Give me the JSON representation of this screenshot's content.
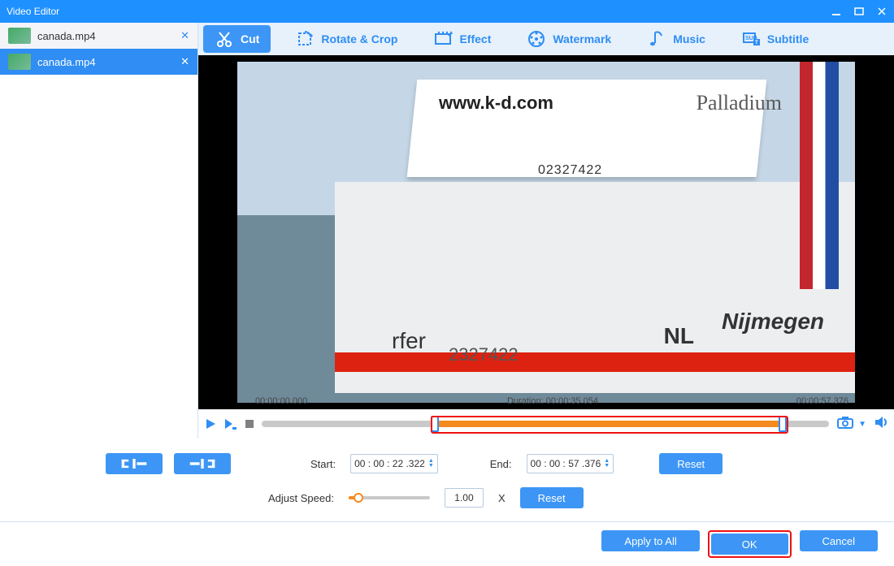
{
  "window": {
    "title": "Video Editor"
  },
  "sidebar": {
    "files": [
      {
        "name": "canada.mp4",
        "active": false
      },
      {
        "name": "canada.mp4",
        "active": true
      }
    ]
  },
  "toolbar": {
    "tabs": [
      {
        "id": "cut",
        "label": "Cut",
        "active": true
      },
      {
        "id": "rotate",
        "label": "Rotate & Crop",
        "active": false
      },
      {
        "id": "effect",
        "label": "Effect",
        "active": false
      },
      {
        "id": "watermark",
        "label": "Watermark",
        "active": false
      },
      {
        "id": "music",
        "label": "Music",
        "active": false
      },
      {
        "id": "subtitle",
        "label": "Subtitle",
        "active": false
      }
    ]
  },
  "preview": {
    "boat_url": "www.k-d.com",
    "boat_name": "Palladium",
    "boat_phone": "02327422",
    "boat_side": "rfer",
    "boat_side_num": "2327422",
    "boat_country": "NL",
    "boat_city": "Nijmegen"
  },
  "timeline": {
    "start_time": "00:00:00.000",
    "duration_label": "Duration:",
    "duration_value": "00:00:35.054",
    "end_time": "00:00:57.376"
  },
  "cut": {
    "start_label": "Start:",
    "start_value": "00 : 00 : 22 .322",
    "end_label": "End:",
    "end_value": "00 : 00 : 57 .376",
    "reset_label": "Reset",
    "speed_label": "Adjust Speed:",
    "speed_value": "1.00",
    "speed_suffix": "X",
    "speed_reset_label": "Reset"
  },
  "footer": {
    "apply_all": "Apply to All",
    "ok": "OK",
    "cancel": "Cancel"
  }
}
